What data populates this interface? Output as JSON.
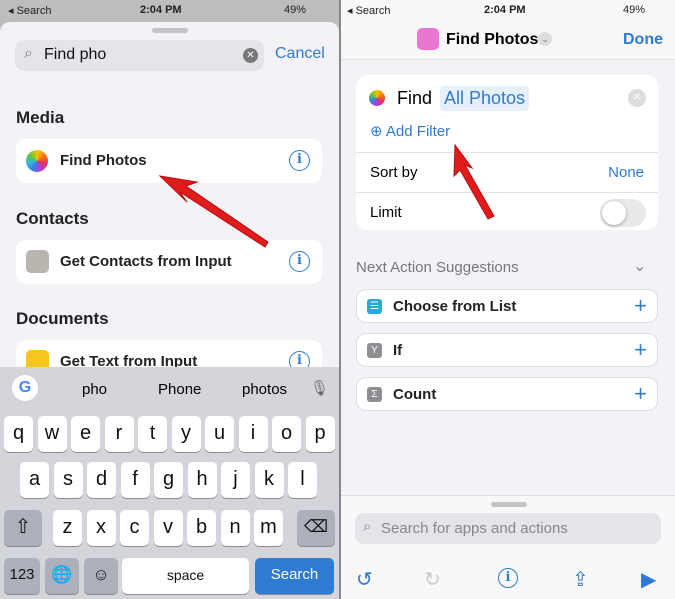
{
  "left": {
    "status": {
      "back": "◂ Search",
      "time": "2:04 PM",
      "battery": "49%"
    },
    "search": {
      "value": "Find pho",
      "cancel": "Cancel"
    },
    "sections": [
      {
        "title": "Media",
        "item": "Find Photos"
      },
      {
        "title": "Contacts",
        "item": "Get Contacts from Input"
      },
      {
        "title": "Documents",
        "item": "Get Text from Input"
      }
    ],
    "keyboard": {
      "suggestions": [
        "pho",
        "Phone",
        "photos"
      ],
      "row1": [
        "q",
        "w",
        "e",
        "r",
        "t",
        "y",
        "u",
        "i",
        "o",
        "p"
      ],
      "row2": [
        "a",
        "s",
        "d",
        "f",
        "g",
        "h",
        "j",
        "k",
        "l"
      ],
      "row3": [
        "z",
        "x",
        "c",
        "v",
        "b",
        "n",
        "m"
      ],
      "num": "123",
      "space": "space",
      "search": "Search"
    }
  },
  "right": {
    "status": {
      "back": "◂ Search",
      "time": "2:04 PM",
      "battery": "49%"
    },
    "header": {
      "title": "Find Photos",
      "done": "Done"
    },
    "card": {
      "find": "Find",
      "param": "All Photos",
      "add_filter": "Add Filter",
      "sort_by": "Sort by",
      "sort_value": "None",
      "limit": "Limit",
      "limit_on": false
    },
    "suggestions_title": "Next Action Suggestions",
    "suggestions": [
      "Choose from List",
      "If",
      "Count"
    ],
    "search_placeholder": "Search for apps and actions"
  },
  "colors": {
    "accent": "#2f7bd3",
    "arrow": "#e01b1b"
  }
}
